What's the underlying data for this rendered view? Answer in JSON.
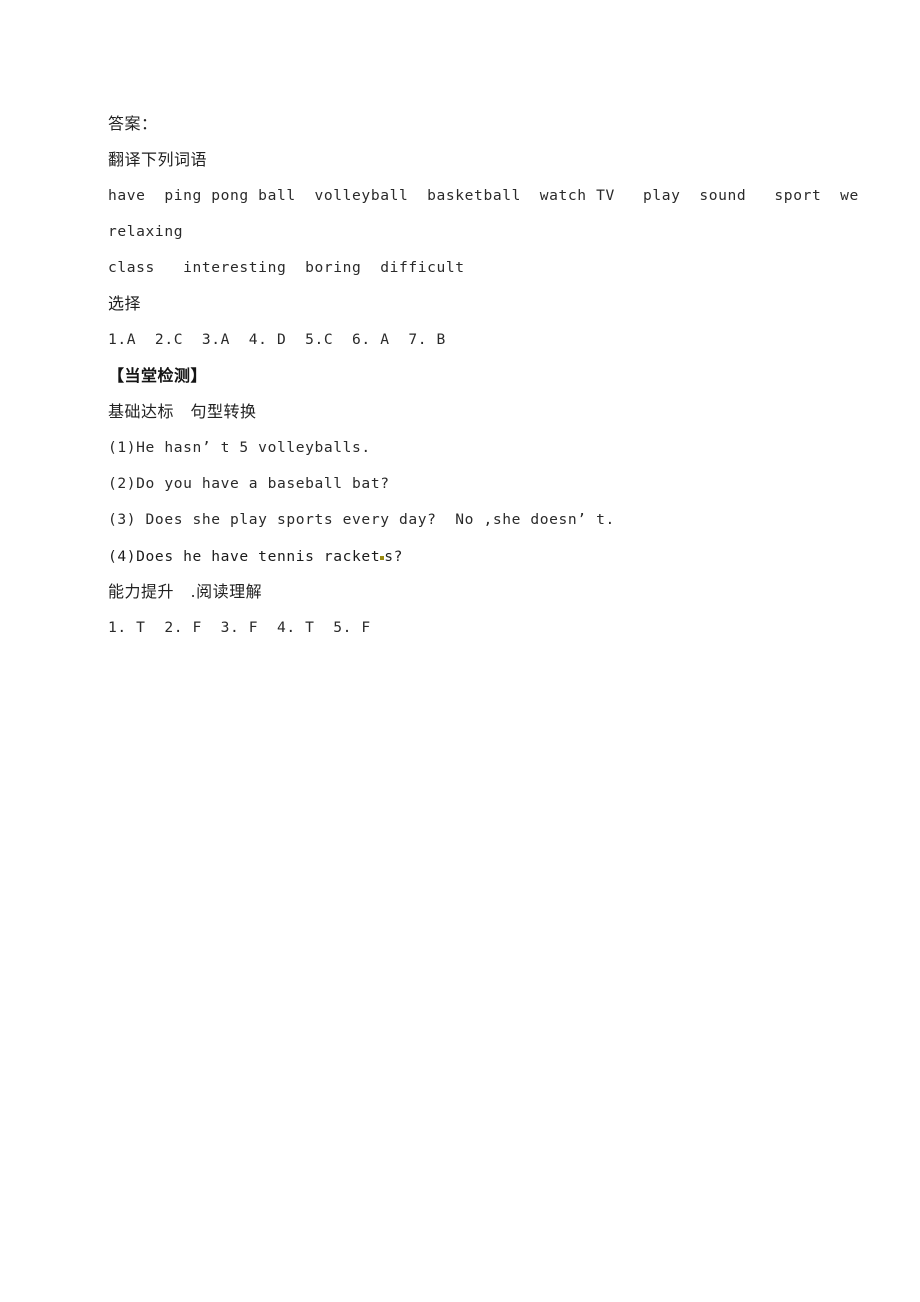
{
  "document": {
    "page_background": "#ffffff",
    "text_color": "#222222",
    "artifact_color": "#9a8b10",
    "lines": [
      {
        "id": "answer-heading",
        "text": "答案：",
        "script": "cjk",
        "bold": false
      },
      {
        "id": "translate-heading",
        "text": "翻译下列词语",
        "script": "cjk",
        "bold": false
      },
      {
        "id": "vocab-line-1",
        "text": "have  ping pong ball  volleyball  basketball  watch TV   play  sound   sport  we",
        "script": "latin",
        "bold": false
      },
      {
        "id": "vocab-line-2",
        "text": "relaxing",
        "script": "latin",
        "bold": false
      },
      {
        "id": "vocab-line-3",
        "text": "class   interesting  boring  difficult",
        "script": "latin",
        "bold": false
      },
      {
        "id": "choice-heading",
        "text": "选择",
        "script": "cjk",
        "bold": false
      },
      {
        "id": "choice-answers",
        "text": "1.A  2.C  3.A  4. D  5.C  6. A  7. B",
        "script": "latin",
        "bold": false
      },
      {
        "id": "section-heading-test",
        "text": "【当堂检测】",
        "script": "cjk",
        "bold": true
      },
      {
        "id": "basic-heading",
        "text": "基础达标　句型转换",
        "script": "cjk",
        "bold": false
      },
      {
        "id": "transform-1",
        "text": "(1)He hasn’ t 5 volleyballs.",
        "script": "latin",
        "bold": false
      },
      {
        "id": "transform-2",
        "text": "(2)Do you have a baseball bat?",
        "script": "latin",
        "bold": false
      },
      {
        "id": "transform-3",
        "text": "(3) Does she play sports every day?  No ,she doesn’ t.",
        "script": "latin",
        "bold": false
      },
      {
        "id": "transform-4",
        "text": "(4)Does he have tennis racket",
        "script": "latin",
        "bold": false,
        "artifact": true,
        "text_after": "s?"
      },
      {
        "id": "ability-heading",
        "text": "能力提升　.阅读理解",
        "script": "cjk",
        "bold": false
      },
      {
        "id": "reading-answers",
        "text": "1. T  2. F  3. F  4. T  5. F",
        "script": "latin",
        "bold": false
      }
    ]
  }
}
